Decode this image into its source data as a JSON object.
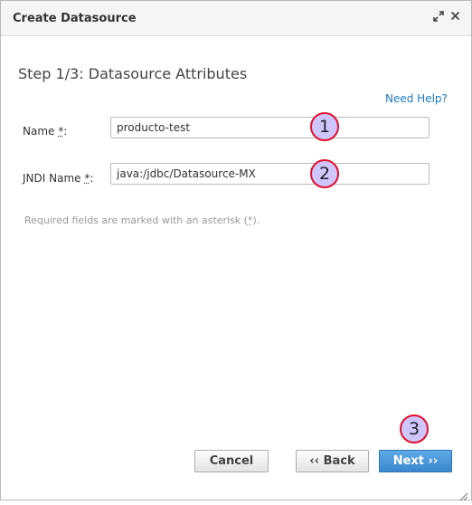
{
  "dialog": {
    "title": "Create Datasource",
    "maximize_icon": "expand-arrows-icon",
    "close_icon": "close-icon"
  },
  "step": {
    "title": "Step 1/3: Datasource Attributes"
  },
  "help_link": "Need Help?",
  "form": {
    "name_label": "Name",
    "name_value": "producto-test",
    "jndi_label": "JNDI Name",
    "jndi_value": "java:/jdbc/Datasource-MX",
    "asterisk": "*",
    "colon": ":"
  },
  "note": {
    "before": "Required fields are marked with an asterisk (",
    "asterisk": "*",
    "after": ")."
  },
  "callouts": [
    "1",
    "2",
    "3"
  ],
  "buttons": {
    "cancel": "Cancel",
    "back": "‹‹ Back",
    "next": "Next ››"
  },
  "colors": {
    "primary_button": "#3b87cf",
    "link": "#1a7bbf",
    "callout_fill": "#cfc6ff",
    "callout_border": "#e0102a"
  }
}
